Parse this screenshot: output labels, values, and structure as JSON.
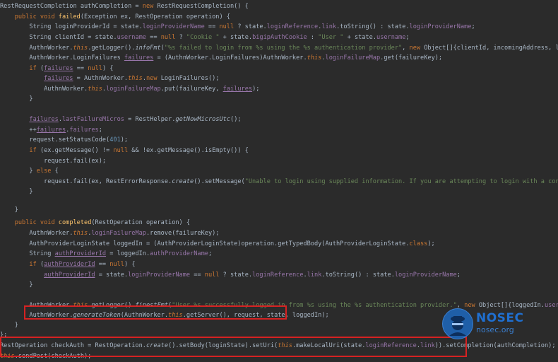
{
  "code_lines": [
    [
      {
        "t": "RestRequestCompletion authCompletion = ",
        "c": ""
      },
      {
        "t": "new ",
        "c": "kwn"
      },
      {
        "t": "RestRequestCompletion() {",
        "c": ""
      }
    ],
    [
      {
        "t": "    ",
        "c": ""
      },
      {
        "t": "public void ",
        "c": "kwn"
      },
      {
        "t": "failed",
        "c": "mth"
      },
      {
        "t": "(Exception ex, RestOperation operation) {",
        "c": ""
      }
    ],
    [
      {
        "t": "        String loginProviderId = state.",
        "c": ""
      },
      {
        "t": "loginProviderName",
        "c": "fld"
      },
      {
        "t": " == ",
        "c": ""
      },
      {
        "t": "null",
        "c": "kwn"
      },
      {
        "t": " ? state.",
        "c": ""
      },
      {
        "t": "loginReference",
        "c": "fld"
      },
      {
        "t": ".",
        "c": ""
      },
      {
        "t": "link",
        "c": "fld"
      },
      {
        "t": ".toString() : state.",
        "c": ""
      },
      {
        "t": "loginProviderName",
        "c": "fld"
      },
      {
        "t": ";",
        "c": ""
      }
    ],
    [
      {
        "t": "        String clientId = state.",
        "c": ""
      },
      {
        "t": "username",
        "c": "fld"
      },
      {
        "t": " == ",
        "c": ""
      },
      {
        "t": "null",
        "c": "kwn"
      },
      {
        "t": " ? ",
        "c": ""
      },
      {
        "t": "\"Cookie \"",
        "c": "str"
      },
      {
        "t": " + state.",
        "c": ""
      },
      {
        "t": "bigipAuthCookie",
        "c": "fld"
      },
      {
        "t": " : ",
        "c": ""
      },
      {
        "t": "\"User \"",
        "c": "str"
      },
      {
        "t": " + state.",
        "c": ""
      },
      {
        "t": "username",
        "c": "fld"
      },
      {
        "t": ";",
        "c": ""
      }
    ],
    [
      {
        "t": "        AuthnWorker.",
        "c": ""
      },
      {
        "t": "this",
        "c": "kw"
      },
      {
        "t": ".getLogger().",
        "c": ""
      },
      {
        "t": "infoFmt",
        "c": "sm"
      },
      {
        "t": "(",
        "c": ""
      },
      {
        "t": "\"%s failed to login from %s using the %s authentication provider\"",
        "c": "str"
      },
      {
        "t": ", ",
        "c": ""
      },
      {
        "t": "new ",
        "c": "kwn"
      },
      {
        "t": "Object[]{clientId, incomingAddress, loginProviderId});",
        "c": ""
      }
    ],
    [
      {
        "t": "        AuthnWorker.LoginFailures ",
        "c": ""
      },
      {
        "t": "failures",
        "c": "fldu"
      },
      {
        "t": " = (AuthnWorker.LoginFailures)AuthnWorker.",
        "c": ""
      },
      {
        "t": "this",
        "c": "kw"
      },
      {
        "t": ".",
        "c": ""
      },
      {
        "t": "loginFailureMap",
        "c": "fld"
      },
      {
        "t": ".get(failureKey);",
        "c": ""
      }
    ],
    [
      {
        "t": "        ",
        "c": ""
      },
      {
        "t": "if ",
        "c": "kwn"
      },
      {
        "t": "(",
        "c": ""
      },
      {
        "t": "failures",
        "c": "fldu"
      },
      {
        "t": " == ",
        "c": ""
      },
      {
        "t": "null",
        "c": "kwn"
      },
      {
        "t": ") {",
        "c": ""
      }
    ],
    [
      {
        "t": "            ",
        "c": ""
      },
      {
        "t": "failures",
        "c": "fldu"
      },
      {
        "t": " = AuthnWorker.",
        "c": ""
      },
      {
        "t": "this",
        "c": "kw"
      },
      {
        "t": ".",
        "c": ""
      },
      {
        "t": "new ",
        "c": "kwn"
      },
      {
        "t": "LoginFailures();",
        "c": ""
      }
    ],
    [
      {
        "t": "            AuthnWorker.",
        "c": ""
      },
      {
        "t": "this",
        "c": "kw"
      },
      {
        "t": ".",
        "c": ""
      },
      {
        "t": "loginFailureMap",
        "c": "fld"
      },
      {
        "t": ".put(failureKey, ",
        "c": ""
      },
      {
        "t": "failures",
        "c": "fldu"
      },
      {
        "t": ");",
        "c": ""
      }
    ],
    [
      {
        "t": "        }",
        "c": ""
      }
    ],
    [
      {
        "t": "",
        "c": ""
      }
    ],
    [
      {
        "t": "        ",
        "c": ""
      },
      {
        "t": "failures",
        "c": "fldu"
      },
      {
        "t": ".",
        "c": ""
      },
      {
        "t": "lastFailureMicros",
        "c": "fld"
      },
      {
        "t": " = RestHelper.",
        "c": ""
      },
      {
        "t": "getNowMicrosUtc",
        "c": "sm"
      },
      {
        "t": "();",
        "c": ""
      }
    ],
    [
      {
        "t": "        ++",
        "c": ""
      },
      {
        "t": "failures",
        "c": "fldu"
      },
      {
        "t": ".",
        "c": ""
      },
      {
        "t": "failures",
        "c": "fld"
      },
      {
        "t": ";",
        "c": ""
      }
    ],
    [
      {
        "t": "        request.setStatusCode(",
        "c": ""
      },
      {
        "t": "401",
        "c": "num"
      },
      {
        "t": ");",
        "c": ""
      }
    ],
    [
      {
        "t": "        ",
        "c": ""
      },
      {
        "t": "if ",
        "c": "kwn"
      },
      {
        "t": "(ex.getMessage() != ",
        "c": ""
      },
      {
        "t": "null",
        "c": "kwn"
      },
      {
        "t": " && !ex.getMessage().isEmpty()) {",
        "c": ""
      }
    ],
    [
      {
        "t": "            request.fail(ex);",
        "c": ""
      }
    ],
    [
      {
        "t": "        } ",
        "c": ""
      },
      {
        "t": "else ",
        "c": "kwn"
      },
      {
        "t": "{",
        "c": ""
      }
    ],
    [
      {
        "t": "            request.fail(ex, RestErrorResponse.",
        "c": ""
      },
      {
        "t": "create",
        "c": "sm"
      },
      {
        "t": "().setMessage(",
        "c": ""
      },
      {
        "t": "\"Unable to login using supplied information. If you are attempting to login with a configured authentication provider",
        "c": "str"
      }
    ],
    [
      {
        "t": "        }",
        "c": ""
      }
    ],
    [
      {
        "t": "",
        "c": ""
      }
    ],
    [
      {
        "t": "    }",
        "c": ""
      }
    ],
    [
      {
        "t": "",
        "c": ""
      }
    ],
    [
      {
        "t": "    ",
        "c": ""
      },
      {
        "t": "public void ",
        "c": "kwn"
      },
      {
        "t": "completed",
        "c": "mth"
      },
      {
        "t": "(RestOperation operation) {",
        "c": ""
      }
    ],
    [
      {
        "t": "        AuthnWorker.",
        "c": ""
      },
      {
        "t": "this",
        "c": "kw"
      },
      {
        "t": ".",
        "c": ""
      },
      {
        "t": "loginFailureMap",
        "c": "fld"
      },
      {
        "t": ".remove(failureKey);",
        "c": ""
      }
    ],
    [
      {
        "t": "        AuthProviderLoginState loggedIn = (AuthProviderLoginState)operation.getTypedBody(AuthProviderLoginState.",
        "c": ""
      },
      {
        "t": "class",
        "c": "kwn"
      },
      {
        "t": ");",
        "c": ""
      }
    ],
    [
      {
        "t": "        String ",
        "c": ""
      },
      {
        "t": "authProviderId",
        "c": "fldu"
      },
      {
        "t": " = loggedIn.",
        "c": ""
      },
      {
        "t": "authProviderName",
        "c": "fld"
      },
      {
        "t": ";",
        "c": ""
      }
    ],
    [
      {
        "t": "        ",
        "c": ""
      },
      {
        "t": "if ",
        "c": "kwn"
      },
      {
        "t": "(",
        "c": ""
      },
      {
        "t": "authProviderId",
        "c": "fldu"
      },
      {
        "t": " == ",
        "c": ""
      },
      {
        "t": "null",
        "c": "kwn"
      },
      {
        "t": ") {",
        "c": ""
      }
    ],
    [
      {
        "t": "            ",
        "c": ""
      },
      {
        "t": "authProviderId",
        "c": "fldu"
      },
      {
        "t": " = state.",
        "c": ""
      },
      {
        "t": "loginProviderName",
        "c": "fld"
      },
      {
        "t": " == ",
        "c": ""
      },
      {
        "t": "null",
        "c": "kwn"
      },
      {
        "t": " ? state.",
        "c": ""
      },
      {
        "t": "loginReference",
        "c": "fld"
      },
      {
        "t": ".",
        "c": ""
      },
      {
        "t": "link",
        "c": "fld"
      },
      {
        "t": ".toString() : state.",
        "c": ""
      },
      {
        "t": "loginProviderName",
        "c": "fld"
      },
      {
        "t": ";",
        "c": ""
      }
    ],
    [
      {
        "t": "        }",
        "c": ""
      }
    ],
    [
      {
        "t": "",
        "c": ""
      }
    ],
    [
      {
        "t": "        AuthnWorker.",
        "c": ""
      },
      {
        "t": "this",
        "c": "kw"
      },
      {
        "t": ".getLogger().",
        "c": ""
      },
      {
        "t": "finestFmt",
        "c": "sm"
      },
      {
        "t": "(",
        "c": ""
      },
      {
        "t": "\"User %s successfully logged in from %s using the %s authentication provider.\"",
        "c": "str"
      },
      {
        "t": ", ",
        "c": ""
      },
      {
        "t": "new ",
        "c": "kwn"
      },
      {
        "t": "Object[]{loggedIn.",
        "c": ""
      },
      {
        "t": "username",
        "c": "fld"
      },
      {
        "t": ", incomingAddress, ",
        "c": ""
      },
      {
        "t": "authProvi",
        "c": "fldu"
      }
    ],
    [
      {
        "t": "        AuthnWorker.",
        "c": ""
      },
      {
        "t": "generateToken",
        "c": "sm"
      },
      {
        "t": "(AuthnWorker.",
        "c": ""
      },
      {
        "t": "this",
        "c": "kw"
      },
      {
        "t": ".getServer(), request, state, loggedIn);",
        "c": ""
      }
    ],
    [
      {
        "t": "    }",
        "c": ""
      }
    ],
    [
      {
        "t": "};",
        "c": ""
      }
    ],
    [
      {
        "t": "RestOperation checkAuth = RestOperation.",
        "c": ""
      },
      {
        "t": "create",
        "c": "sm"
      },
      {
        "t": "().setBody(loginState).setUri(",
        "c": ""
      },
      {
        "t": "this",
        "c": "kw"
      },
      {
        "t": ".makeLocalUri(state.",
        "c": ""
      },
      {
        "t": "loginReference",
        "c": "fld"
      },
      {
        "t": ".",
        "c": ""
      },
      {
        "t": "link",
        "c": "fld"
      },
      {
        "t": ")).setCompletion(authCompletion);",
        "c": ""
      }
    ],
    [
      {
        "t": "this",
        "c": "kw"
      },
      {
        "t": ".sendPost(checkAuth);",
        "c": ""
      }
    ]
  ],
  "watermark": {
    "title": "NOSEC",
    "subtitle": "nosec.org"
  },
  "colors": {
    "background": "#2b2b2b",
    "highlight_box": "#d62222",
    "keyword": "#cc7832",
    "field": "#9876aa",
    "string": "#6a8759",
    "method": "#ffc66d"
  }
}
